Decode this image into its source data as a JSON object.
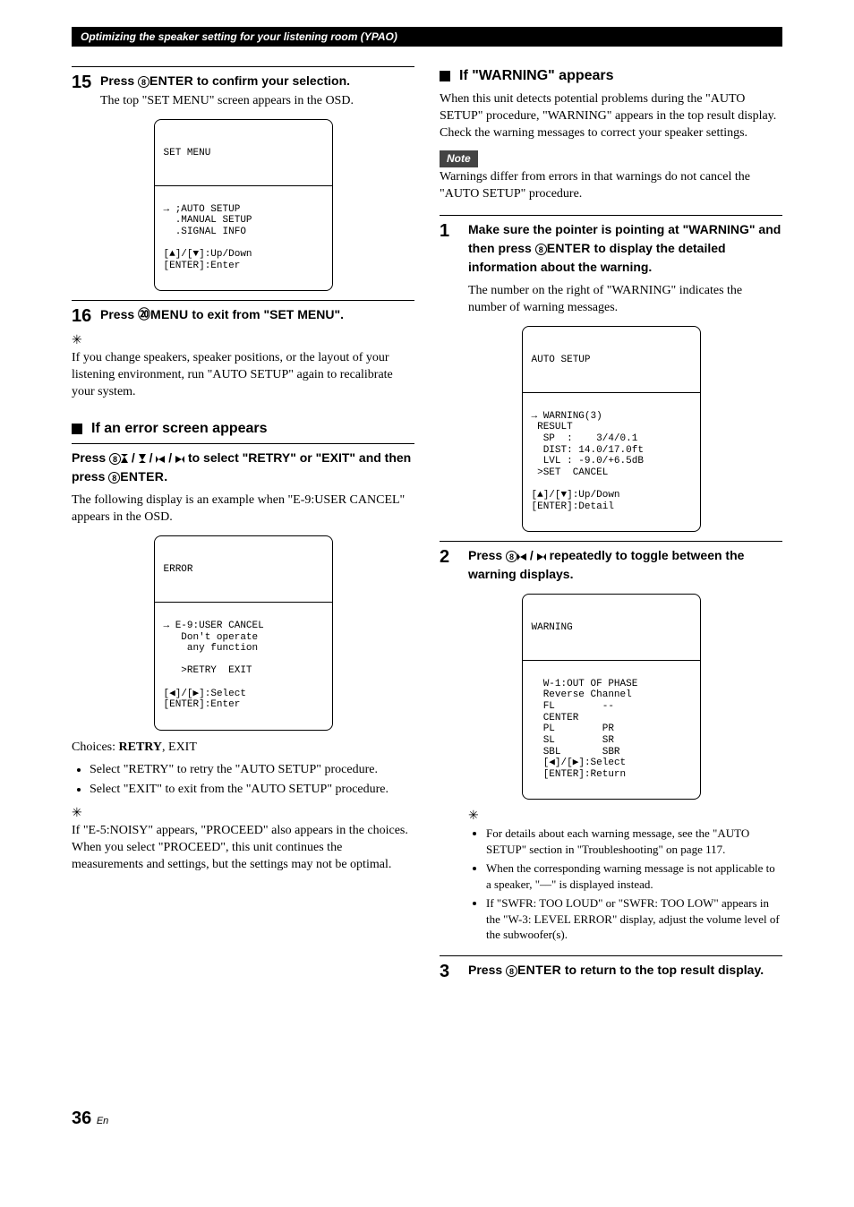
{
  "header": {
    "title": "Optimizing the speaker setting for your listening room (YPAO)"
  },
  "left": {
    "steps": {
      "s15": {
        "num": "15",
        "bold_pre": "Press ",
        "icon_circle": "8",
        "bold_keyword": "ENTER",
        "bold_post": " to confirm your selection.",
        "desc": "The top \"SET MENU\" screen appears in the OSD."
      },
      "osd1": {
        "title": "SET MENU",
        "body": "→ ;AUTO SETUP\n  .MANUAL SETUP\n  .SIGNAL INFO",
        "hint": "[▲]/[▼]:Up/Down\n[ENTER]:Enter"
      },
      "s16": {
        "num": "16",
        "bold_pre": "Press ",
        "icon_circle": "⑳",
        "bold_keyword": "MENU",
        "bold_post": " to exit from \"SET MENU\"."
      },
      "tip1": "If you change speakers, speaker positions, or the layout of your listening environment, run \"AUTO SETUP\" again to recalibrate your system."
    },
    "error": {
      "title": "If an error screen appears",
      "instruction_pre": "Press ",
      "circle": "8",
      "instruction_mid": " to select \"RETRY\" or \"EXIT\" and then press ",
      "enter": "ENTER",
      "instruction_end": ".",
      "desc": "The following display is an example when \"E-9:USER CANCEL\" appears in the OSD.",
      "osd": {
        "title": "ERROR",
        "body": "→ E-9:USER CANCEL\n   Don't operate\n    any function",
        "options": "   >RETRY  EXIT",
        "hint": "[◀]/[▶]:Select\n[ENTER]:Enter"
      },
      "choices_label": "Choices: ",
      "choices_bold": "RETRY",
      "choices_rest": ", EXIT",
      "bul1": "Select \"RETRY\" to retry the \"AUTO SETUP\" procedure.",
      "bul2": "Select \"EXIT\" to exit from the \"AUTO SETUP\" procedure.",
      "tip": "If \"E-5:NOISY\" appears, \"PROCEED\" also appears in the choices. When you select \"PROCEED\", this unit continues the measurements and settings, but the settings may not be optimal."
    }
  },
  "right": {
    "warning": {
      "title": "If \"WARNING\" appears",
      "body": "When this unit detects potential problems during the \"AUTO SETUP\" procedure, \"WARNING\" appears in the top result display. Check the warning messages to correct your speaker settings.",
      "note": "Warnings differ from errors in that warnings do not cancel the \"AUTO SETUP\" procedure.",
      "s1": {
        "num": "1",
        "bold_pre": "Make sure the pointer is pointing at \"WARNING\" and then press ",
        "circle": "8",
        "keyword": "ENTER",
        "bold_post": " to display the detailed information about the warning.",
        "desc": "The number on the right of \"WARNING\" indicates the number of warning messages.",
        "osd": {
          "title": "AUTO SETUP",
          "body": "→ WARNING(3)\n RESULT\n  SP  :    3/4/0.1\n  DIST: 14.0/17.0ft\n  LVL : -9.0/+6.5dB\n >SET  CANCEL",
          "hint": "[▲]/[▼]:Up/Down\n[ENTER]:Detail"
        }
      },
      "s2": {
        "num": "2",
        "bold_pre": "Press ",
        "circle": "8",
        "bold_post": " repeatedly to toggle between the warning displays.",
        "osd": {
          "title": "WARNING",
          "body": "  W-1:OUT OF PHASE\n  Reverse Channel\n  FL        --\n  CENTER\n  PL        PR\n  SL        SR\n  SBL       SBR\n  [◀]/[▶]:Select\n  [ENTER]:Return"
        },
        "bul1": "For details about each warning message, see the \"AUTO SETUP\" section in \"Troubleshooting\" on page 117.",
        "bul2": "When the corresponding warning message is not applicable to a speaker, \"––\" is displayed instead.",
        "bul3": "If \"SWFR: TOO LOUD\" or \"SWFR: TOO LOW\" appears in the \"W-3: LEVEL ERROR\" display, adjust the volume level of the subwoofer(s)."
      },
      "s3": {
        "num": "3",
        "bold_pre": "Press ",
        "circle": "8",
        "keyword": "ENTER",
        "bold_post": " to return to the top result display."
      }
    }
  },
  "page": {
    "num": "36",
    "suffix": "En"
  }
}
